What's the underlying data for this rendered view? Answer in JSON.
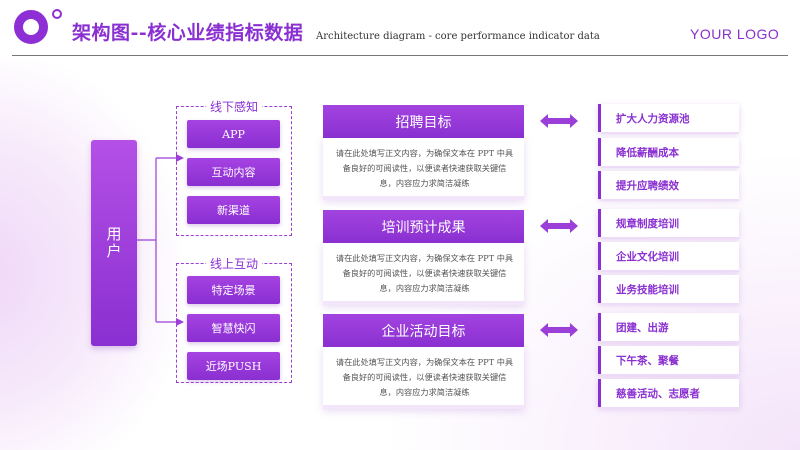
{
  "header": {
    "title": "架构图--核心业绩指标数据",
    "subtitle": "Architecture diagram - core performance indicator data",
    "logo_text": "YOUR LOGO"
  },
  "user_label": "用户",
  "offline_group": {
    "title": "线下感知",
    "items": [
      "APP",
      "互动内容",
      "新渠道"
    ]
  },
  "online_group": {
    "title": "线上互动",
    "items": [
      "特定场景",
      "智慧快闪",
      "近场PUSH"
    ]
  },
  "panels": [
    {
      "title": "招聘目标",
      "text": "请在此处填写正文内容，为确保文本在 PPT 中具备良好的可阅读性，以便读者快速获取关键信息，内容应力求简洁凝练",
      "items": [
        "扩大人力资源池",
        "降低薪酬成本",
        "提升应聘绩效"
      ]
    },
    {
      "title": "培训预计成果",
      "text": "请在此处填写正文内容，为确保文本在 PPT 中具备良好的可阅读性，以便读者快速获取关键信息，内容应力求简洁凝练",
      "items": [
        "规章制度培训",
        "企业文化培训",
        "业务技能培训"
      ]
    },
    {
      "title": "企业活动目标",
      "text": "请在此处填写正文内容，为确保文本在 PPT 中具备良好的可阅读性，以便读者快速获取关键信息，内容应力求简洁凝练",
      "items": [
        "团建、出游",
        "下午茶、聚餐",
        "慈善活动、志愿者"
      ]
    }
  ],
  "colors": {
    "accent": "#8a2fd1",
    "accent_light": "#b450e6",
    "arrow": "#9b3fd8"
  }
}
